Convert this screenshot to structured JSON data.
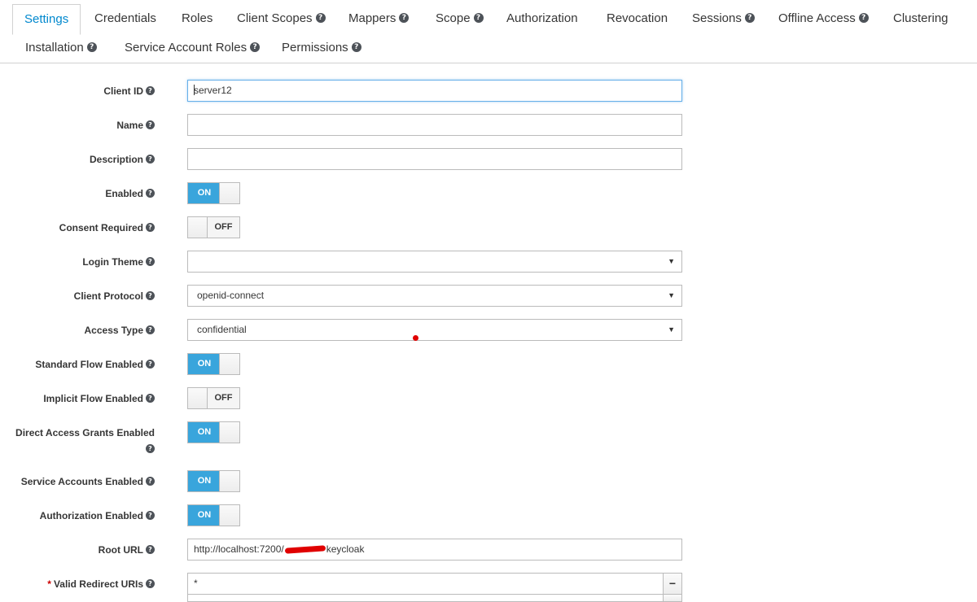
{
  "tabs": [
    {
      "label": "Settings",
      "help": false
    },
    {
      "label": "Credentials",
      "help": false
    },
    {
      "label": "Roles",
      "help": false
    },
    {
      "label": "Client Scopes",
      "help": true
    },
    {
      "label": "Mappers",
      "help": true
    },
    {
      "label": "Scope",
      "help": true
    },
    {
      "label": "Authorization",
      "help": false
    },
    {
      "label": "Revocation",
      "help": false
    },
    {
      "label": "Sessions",
      "help": true
    },
    {
      "label": "Offline Access",
      "help": true
    },
    {
      "label": "Clustering",
      "help": false
    },
    {
      "label": "Installation",
      "help": true
    },
    {
      "label": "Service Account Roles",
      "help": true
    },
    {
      "label": "Permissions",
      "help": true
    }
  ],
  "form": {
    "client_id": {
      "label": "Client ID",
      "value": "server12"
    },
    "name": {
      "label": "Name",
      "value": ""
    },
    "description": {
      "label": "Description",
      "value": ""
    },
    "enabled": {
      "label": "Enabled",
      "state": "ON"
    },
    "consent_required": {
      "label": "Consent Required",
      "state": "OFF"
    },
    "login_theme": {
      "label": "Login Theme",
      "value": ""
    },
    "client_protocol": {
      "label": "Client Protocol",
      "value": "openid-connect"
    },
    "access_type": {
      "label": "Access Type",
      "value": "confidential"
    },
    "standard_flow": {
      "label": "Standard Flow Enabled",
      "state": "ON"
    },
    "implicit_flow": {
      "label": "Implicit Flow Enabled",
      "state": "OFF"
    },
    "direct_access": {
      "label": "Direct Access Grants Enabled",
      "state": "ON"
    },
    "service_accounts": {
      "label": "Service Accounts Enabled",
      "state": "ON"
    },
    "authorization": {
      "label": "Authorization Enabled",
      "state": "ON"
    },
    "root_url": {
      "label": "Root URL",
      "value_prefix": "http://localhost:7200/",
      "value_suffix": "keycloak"
    },
    "redirect_uris": {
      "label": "Valid Redirect URIs",
      "required_mark": "*",
      "value": "*"
    }
  },
  "icons": {
    "help": "question-circle-icon",
    "select": "caret-down-icon",
    "remove": "minus-icon"
  },
  "colors": {
    "accent": "#0088ce",
    "switch_on": "#39a5dc",
    "required": "#cc0000",
    "annotation": "#e00000"
  }
}
